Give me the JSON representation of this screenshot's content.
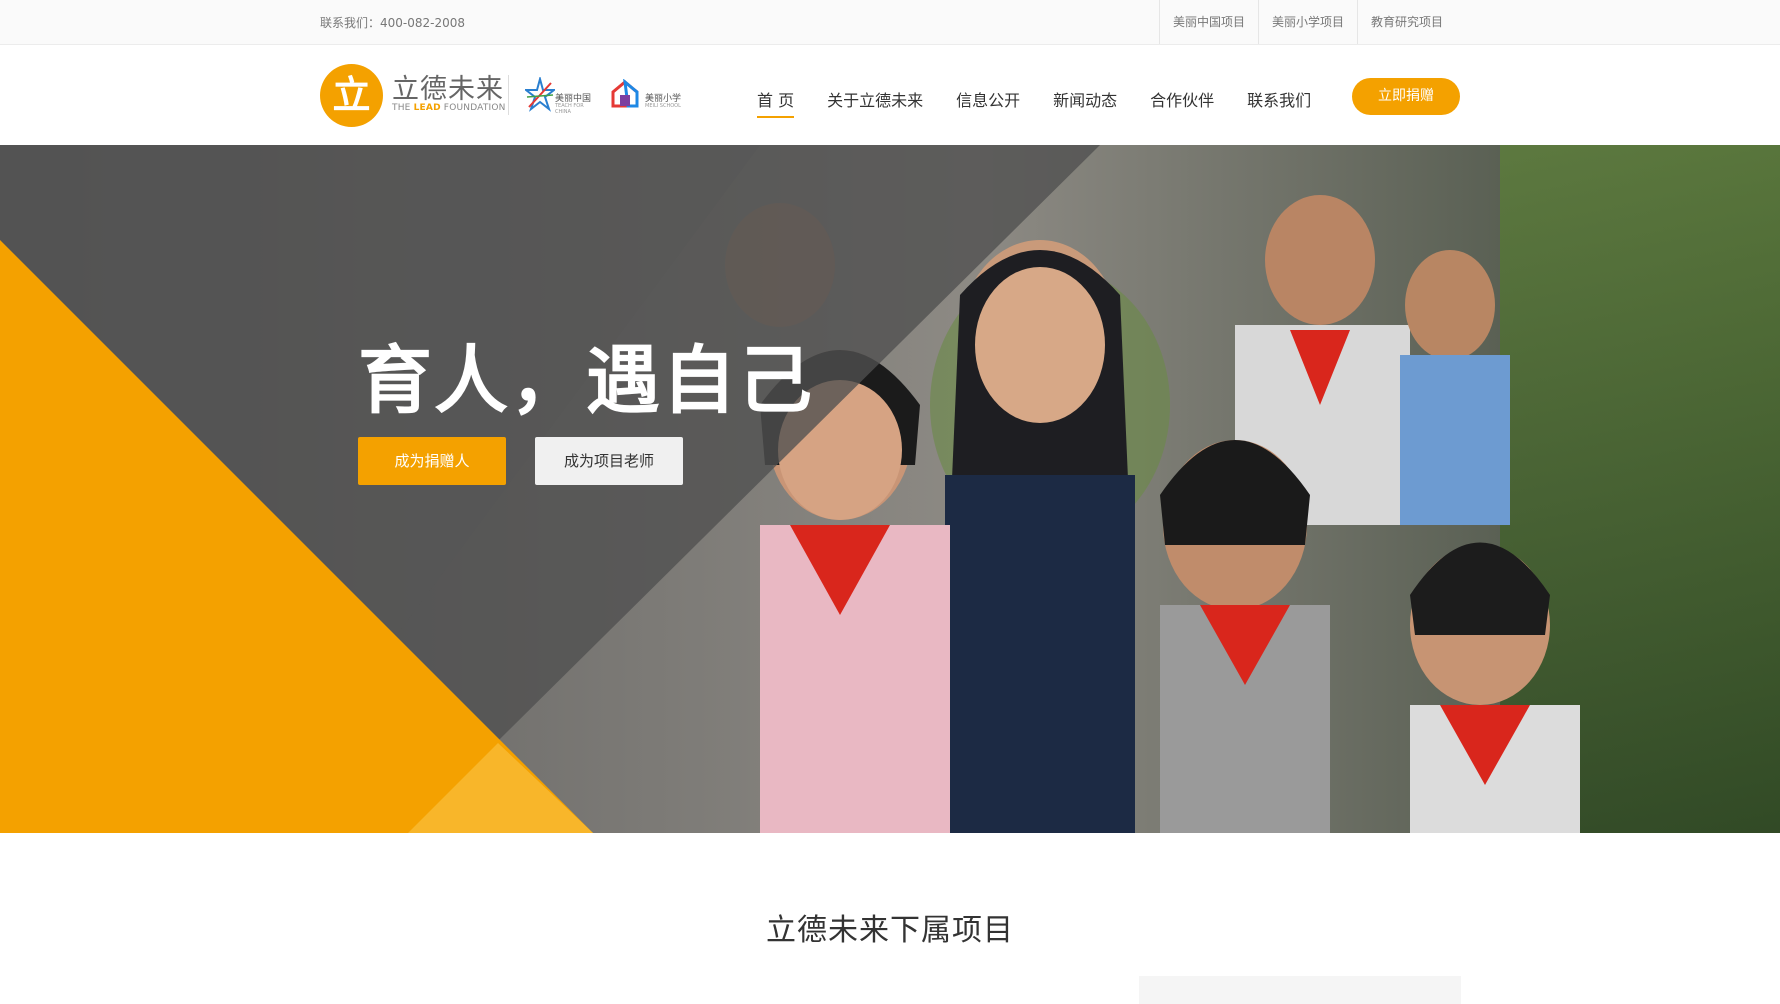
{
  "topbar": {
    "contact": "联系我们：400-082-2008",
    "links": [
      "美丽中国项目",
      "美丽小学项目",
      "教育研究项目"
    ]
  },
  "logo": {
    "glyph": "立",
    "cn": "立德未来",
    "en_the": "THE ",
    "en_lead": "LEAD",
    "en_foundation": " FOUNDATION",
    "partner1_cn": "美丽中国",
    "partner1_en": "TEACH FOR CHINA",
    "partner2_cn": "美丽小学",
    "partner2_en": "MEILI SCHOOL"
  },
  "nav": {
    "items": [
      "首 页",
      "关于立德未来",
      "信息公开",
      "新闻动态",
      "合作伙伴",
      "联系我们"
    ],
    "donate": "立即捐赠"
  },
  "hero": {
    "headline": "育人，遇自己",
    "primary_button": "成为捐赠人",
    "secondary_button": "成为项目老师"
  },
  "section": {
    "title": "立德未来下属项目"
  },
  "colors": {
    "accent": "#f4a100",
    "accent_light": "#f8b62a",
    "overlay": "#505050"
  }
}
